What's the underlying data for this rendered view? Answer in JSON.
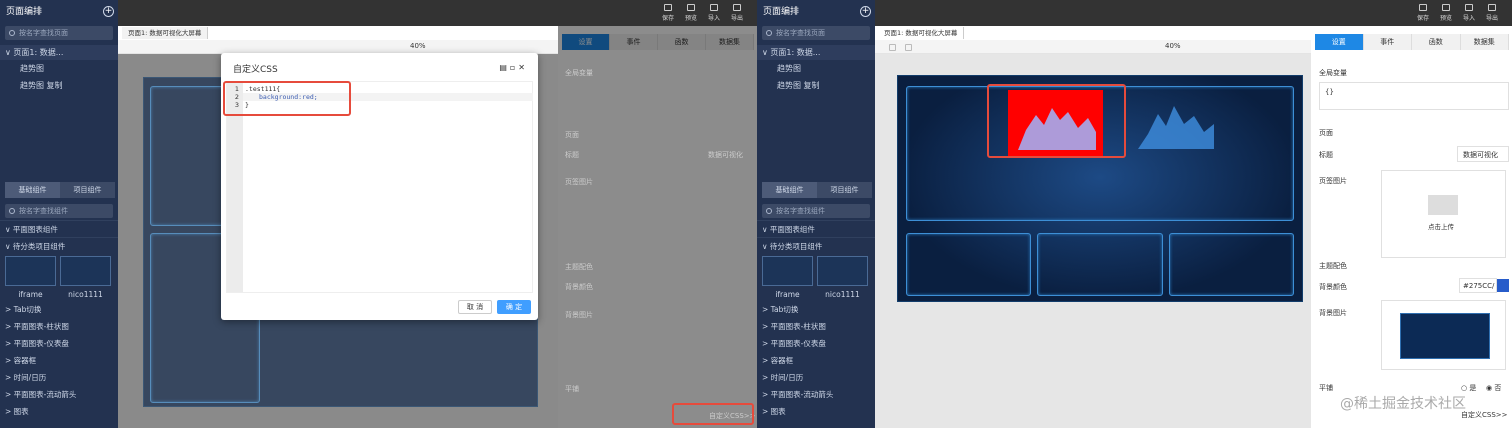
{
  "sidebar": {
    "title": "页面编排",
    "search_placeholder": "按名字查找页面",
    "group": "页面1: 数据...",
    "pages": [
      "趋势图",
      "趋势图 复制"
    ],
    "tabs": [
      "基础组件",
      "项目组件"
    ],
    "comp_search_placeholder": "按名字查找组件",
    "sections": [
      "平面图表组件",
      "待分类项目组件"
    ],
    "cards": [
      "iframe",
      "nico1111"
    ],
    "categories": [
      "Tab切换",
      "平面图表-柱状图",
      "平面图表-仪表盘",
      "容器框",
      "时间/日历",
      "平面图表-流动箭头",
      "图表"
    ]
  },
  "toolbar": {
    "save": "保存",
    "preview": "预览",
    "import": "导入",
    "export": "导出",
    "zoom": "40%"
  },
  "doc_tab": "页面1: 数据可视化大屏幕",
  "right": {
    "tabs": [
      "设置",
      "事件",
      "函数",
      "数据集"
    ],
    "global_var": "全局变量",
    "global_var_value": "{}",
    "page": "页面",
    "title_label": "标题",
    "title_value": "数据可视化",
    "icon_label": "页签图片",
    "upload": "点击上传",
    "theme": "主题配色",
    "bg_color_label": "背景颜色",
    "bg_color": "#275CC/",
    "bg_image": "背景图片",
    "tile": "平铺",
    "yes": "是",
    "no": "否",
    "custom_css": "自定义CSS>>"
  },
  "dialog": {
    "title": "自定义CSS",
    "lines": [
      ".test111{",
      "background:red;",
      "}"
    ],
    "line_nos": [
      "1",
      "2",
      "3"
    ],
    "cancel": "取 消",
    "ok": "确 定"
  },
  "watermark": "@稀土掘金技术社区",
  "colors": {
    "sidebar": "#233250",
    "accent": "#1e88e5",
    "highlight": "#e64b3c",
    "screen": "#0c2449",
    "red_chart": "#ff0000"
  }
}
